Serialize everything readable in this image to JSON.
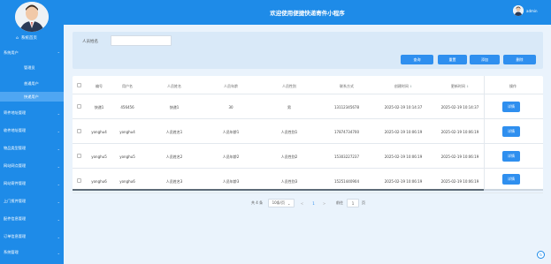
{
  "header": {
    "title": "欢迎使用便捷快递寄件小程序",
    "user_name": "admin"
  },
  "sidebar": {
    "home": "系统首页",
    "groups": [
      {
        "label": "系统用户",
        "open": true
      },
      {
        "label": "寄件地址管理"
      },
      {
        "label": "收件地址管理"
      },
      {
        "label": "物品类型管理"
      },
      {
        "label": "网站网点管理"
      },
      {
        "label": "网站寄件管理"
      },
      {
        "label": "上门揽件管理"
      },
      {
        "label": "配件信息管理"
      },
      {
        "label": "订单信息管理"
      },
      {
        "label": "系统管理"
      }
    ],
    "sub_items": [
      {
        "label": "管理员"
      },
      {
        "label": "普通用户"
      },
      {
        "label": "快递用户",
        "active": true
      }
    ]
  },
  "search": {
    "label": "人员姓名",
    "value": "",
    "placeholder": ""
  },
  "buttons": {
    "query": "查询",
    "reset": "重置",
    "add": "添加",
    "delete": "删除"
  },
  "table": {
    "columns": [
      "编号",
      "用户名",
      "人员姓名",
      "人员年龄",
      "人员性别",
      "联系方式",
      "创建时间",
      "更新时间",
      "操作"
    ],
    "rows": [
      [
        "快递1",
        "456456",
        "快递1",
        "30",
        "男",
        "13112345678",
        "2025-02-19 10:14:37",
        "2025-02-19 10:14:37"
      ],
      [
        "yonghu4",
        "yonghu4",
        "人员姓名1",
        "人员年龄1",
        "人员性别1",
        "17874734700",
        "2025-02-19 10:06:19",
        "2025-02-19 10:06:19"
      ],
      [
        "yonghu5",
        "yonghu5",
        "人员姓名2",
        "人员年龄2",
        "人员性别2",
        "15303227237",
        "2025-02-19 10:06:19",
        "2025-02-19 10:06:19"
      ],
      [
        "yonghu6",
        "yonghu6",
        "人员姓名3",
        "人员年龄3",
        "人员性别3",
        "15251440904",
        "2025-02-19 10:06:19",
        "2025-02-19 10:06:19"
      ]
    ],
    "detail_label": "详情"
  },
  "pagination": {
    "total": "共 4 条",
    "page_size": "10条/页",
    "prev": "<",
    "current": "1",
    "next": ">",
    "goto_label": "前往",
    "goto_value": "1",
    "page_unit": "页"
  },
  "colors": {
    "primary": "#1e8be8",
    "button": "#2f8fef",
    "background": "#eaf3fc"
  }
}
